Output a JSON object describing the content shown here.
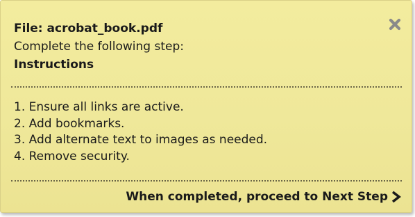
{
  "dialog": {
    "file_label": "File: acrobat_book.pdf",
    "step_prompt": "Complete the following step:",
    "instructions_title": "Instructions",
    "steps": [
      "1. Ensure all links are active.",
      "2. Add bookmarks.",
      "3. Add alternate text to images as needed.",
      "4. Remove security."
    ],
    "next_step_label": "When completed, proceed to Next Step",
    "close_icon": "close-x-icon",
    "next_icon": "chevron-right-icon"
  },
  "colors": {
    "panel_background": "#f0e99c",
    "text": "#1a1a1a",
    "close_icon": "#8a8a8a",
    "divider": "#6b6647"
  }
}
